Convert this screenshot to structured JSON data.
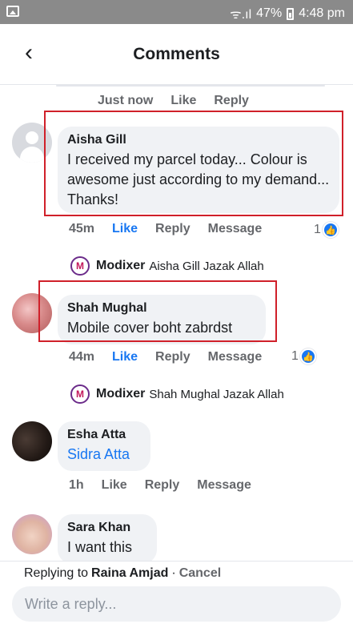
{
  "status_bar": {
    "signal": "ᯤ.ıl",
    "battery": "47%",
    "time": "4:48 pm"
  },
  "header": {
    "title": "Comments",
    "back_icon": "‹"
  },
  "prev_comment_actions": {
    "time": "Just now",
    "like": "Like",
    "reply": "Reply"
  },
  "comments": [
    {
      "author": "Aisha Gill",
      "text": "I received my parcel today... Colour is awesome just according to my demand... Thanks!",
      "time": "45m",
      "like": "Like",
      "reply": "Reply",
      "message": "Message",
      "reactions": "1",
      "reply_preview": {
        "author": "Modixer",
        "text": "Aisha Gill Jazak Allah",
        "badge": "M"
      }
    },
    {
      "author": "Shah Mughal",
      "text": "Mobile cover boht zabrdst",
      "time": "44m",
      "like": "Like",
      "reply": "Reply",
      "message": "Message",
      "reactions": "1",
      "reply_preview": {
        "author": "Modixer",
        "text": "Shah Mughal Jazak Allah",
        "badge": "M"
      }
    },
    {
      "author": "Esha Atta",
      "text": "Sidra Atta",
      "time": "1h",
      "like": "Like",
      "reply": "Reply",
      "message": "Message"
    },
    {
      "author": "Sara Khan",
      "text": "I want this"
    }
  ],
  "composer": {
    "replying_prefix": "Replying to",
    "replying_target": "Raina Amjad",
    "separator": "·",
    "cancel": "Cancel",
    "placeholder": "Write a reply..."
  },
  "colors": {
    "accent": "#1877f2",
    "highlight": "#d0202a",
    "status_bar": "#8a8a8a"
  }
}
